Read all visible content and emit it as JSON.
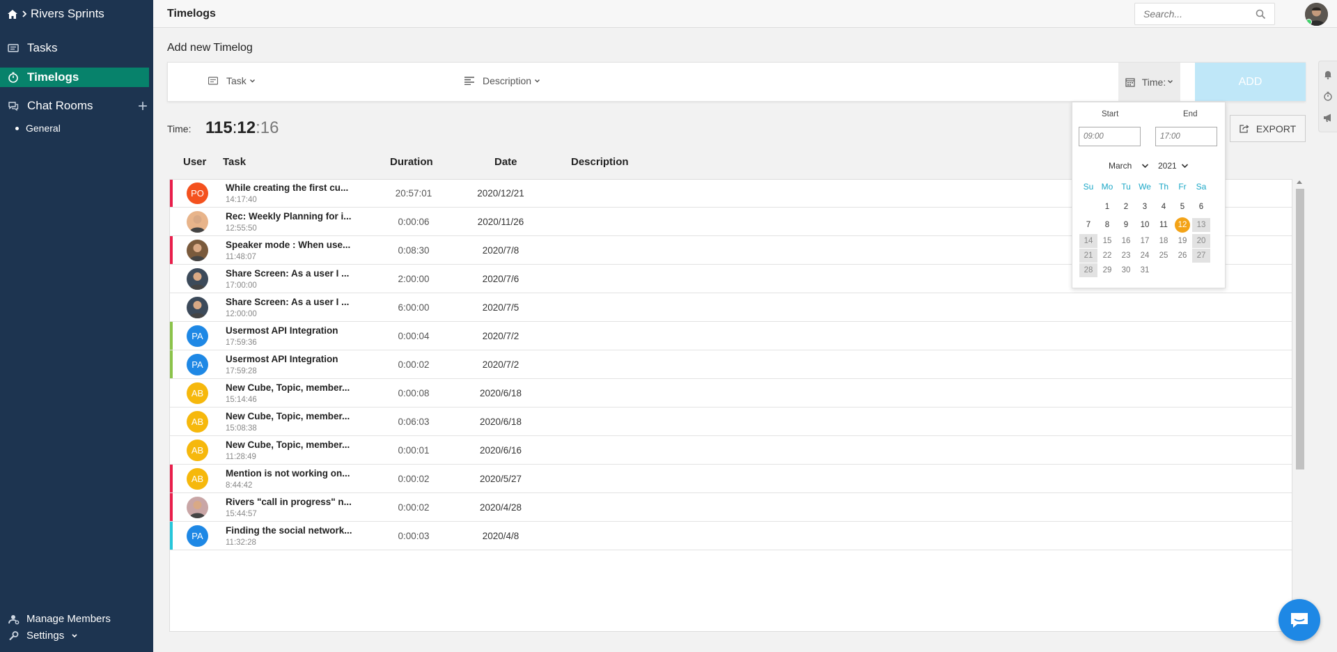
{
  "sidebar": {
    "project": "Rivers Sprints",
    "nav": [
      {
        "label": "Tasks"
      },
      {
        "label": "Timelogs"
      },
      {
        "label": "Chat Rooms"
      }
    ],
    "chat_rooms": [
      "General"
    ],
    "manage_members": "Manage Members",
    "settings": "Settings"
  },
  "header": {
    "title": "Timelogs",
    "search_placeholder": "Search..."
  },
  "add_form": {
    "title": "Add new Timelog",
    "task_label": "Task",
    "description_label": "Description",
    "time_label": "Time:",
    "add_button": "ADD"
  },
  "total": {
    "label": "Time:",
    "hours": "115",
    "minutes": "12",
    "seconds": "16"
  },
  "export_label": "EXPORT",
  "table": {
    "headers": {
      "user": "User",
      "task": "Task",
      "duration": "Duration",
      "date": "Date",
      "description": "Description"
    },
    "rows": [
      {
        "initials": "PO",
        "avatar_color": "#f4511e",
        "stripe": "#e91e4b",
        "task": "While creating the first cu...",
        "time": "14:17:40",
        "duration": "20:57:01",
        "date": "2020/12/21"
      },
      {
        "initials": "",
        "avatar_color": "#e8b48a",
        "stripe": "",
        "task": "Rec: Weekly Planning for i...",
        "time": "12:55:50",
        "duration": "0:00:06",
        "date": "2020/11/26"
      },
      {
        "initials": "",
        "avatar_color": "#7a5a3c",
        "stripe": "#e91e4b",
        "task": "Speaker mode : When use...",
        "time": "11:48:07",
        "duration": "0:08:30",
        "date": "2020/7/8"
      },
      {
        "initials": "",
        "avatar_color": "#3c4a5a",
        "stripe": "",
        "task": "Share Screen: As a user I ...",
        "time": "17:00:00",
        "duration": "2:00:00",
        "date": "2020/7/6"
      },
      {
        "initials": "",
        "avatar_color": "#3c4a5a",
        "stripe": "",
        "task": "Share Screen: As a user I ...",
        "time": "12:00:00",
        "duration": "6:00:00",
        "date": "2020/7/5"
      },
      {
        "initials": "PA",
        "avatar_color": "#1e88e5",
        "stripe": "#8bc34a",
        "task": "Usermost API Integration",
        "time": "17:59:36",
        "duration": "0:00:04",
        "date": "2020/7/2"
      },
      {
        "initials": "PA",
        "avatar_color": "#1e88e5",
        "stripe": "#8bc34a",
        "task": "Usermost API Integration",
        "time": "17:59:28",
        "duration": "0:00:02",
        "date": "2020/7/2"
      },
      {
        "initials": "AB",
        "avatar_color": "#f6b80c",
        "stripe": "",
        "task": "New Cube, Topic, member...",
        "time": "15:14:46",
        "duration": "0:00:08",
        "date": "2020/6/18"
      },
      {
        "initials": "AB",
        "avatar_color": "#f6b80c",
        "stripe": "",
        "task": "New Cube, Topic, member...",
        "time": "15:08:38",
        "duration": "0:06:03",
        "date": "2020/6/18"
      },
      {
        "initials": "AB",
        "avatar_color": "#f6b80c",
        "stripe": "",
        "task": "New Cube, Topic, member...",
        "time": "11:28:49",
        "duration": "0:00:01",
        "date": "2020/6/16"
      },
      {
        "initials": "AB",
        "avatar_color": "#f6b80c",
        "stripe": "#e91e4b",
        "task": "Mention is not working on...",
        "time": "8:44:42",
        "duration": "0:00:02",
        "date": "2020/5/27"
      },
      {
        "initials": "",
        "avatar_color": "#c9a6a6",
        "stripe": "#e91e4b",
        "task": "Rivers \"call in progress\" n...",
        "time": "15:44:57",
        "duration": "0:00:02",
        "date": "2020/4/28"
      },
      {
        "initials": "PA",
        "avatar_color": "#1e88e5",
        "stripe": "#26c6da",
        "task": "Finding the social network...",
        "time": "11:32:28",
        "duration": "0:00:03",
        "date": "2020/4/8"
      }
    ]
  },
  "date_picker": {
    "start_label": "Start",
    "end_label": "End",
    "start_placeholder": "09:00",
    "end_placeholder": "17:00",
    "month": "March",
    "year": "2021",
    "weekdays": [
      "Su",
      "Mo",
      "Tu",
      "We",
      "Th",
      "Fr",
      "Sa"
    ],
    "today": 12,
    "days_in_month": 31,
    "first_weekday": 1
  },
  "colors": {
    "sidebar": "#1d3450",
    "active": "#07826b",
    "add_button": "#bfe7f8",
    "today": "#f3a317",
    "weekday": "#1aa7c7"
  }
}
